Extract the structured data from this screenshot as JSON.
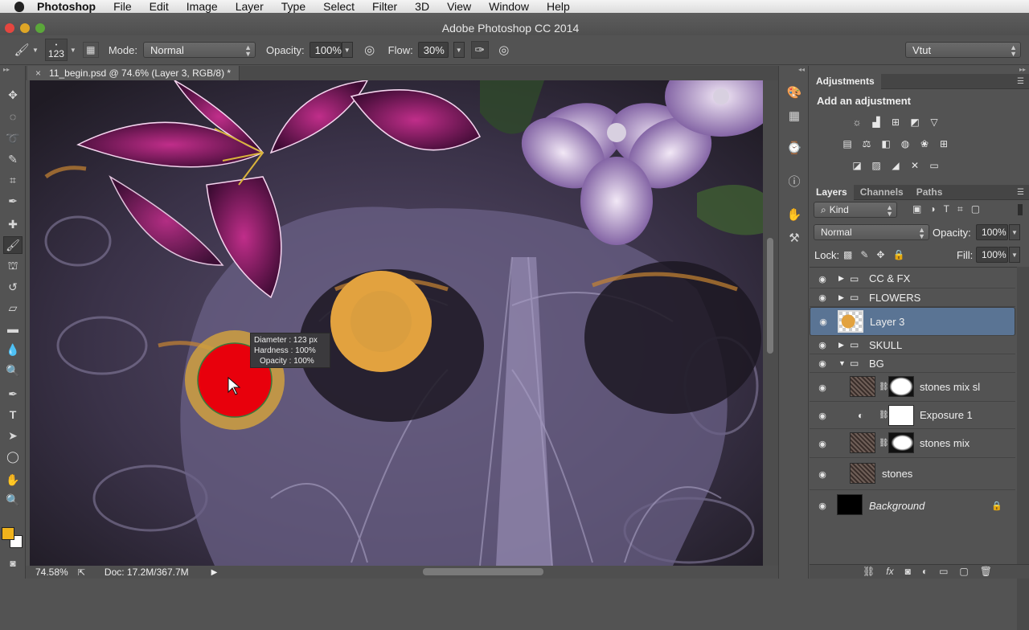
{
  "menubar": {
    "app_name": "Photoshop",
    "items": [
      "File",
      "Edit",
      "Image",
      "Layer",
      "Type",
      "Select",
      "Filter",
      "3D",
      "View",
      "Window",
      "Help"
    ]
  },
  "window": {
    "title": "Adobe Photoshop CC 2014"
  },
  "options_bar": {
    "brush_size": "123",
    "mode_label": "Mode:",
    "mode_value": "Normal",
    "opacity_label": "Opacity:",
    "opacity_value": "100%",
    "flow_label": "Flow:",
    "flow_value": "30%",
    "workspace": "Vtut"
  },
  "document": {
    "tab_title": "11_begin.psd @ 74.6% (Layer 3, RGB/8) *",
    "close_glyph": "×"
  },
  "brush_tooltip": {
    "diameter_label": "Diameter :",
    "diameter_value": "123 px",
    "hardness_label": "Hardness :",
    "hardness_value": "100%",
    "opacity_label": "Opacity :",
    "opacity_value": "100%"
  },
  "status": {
    "zoom": "74.58%",
    "doc_info": "Doc: 17.2M/367.7M"
  },
  "adjustments": {
    "panel_title": "Adjustments",
    "heading": "Add an adjustment"
  },
  "layers_panel": {
    "tabs": [
      "Layers",
      "Channels",
      "Paths"
    ],
    "filter_kind": "Kind",
    "blend_mode": "Normal",
    "opacity_label": "Opacity:",
    "opacity_value": "100%",
    "lock_label": "Lock:",
    "fill_label": "Fill:",
    "fill_value": "100%",
    "layers": [
      {
        "name": "CC & FX",
        "type": "group"
      },
      {
        "name": "FLOWERS",
        "type": "group"
      },
      {
        "name": "Layer 3",
        "type": "pixel",
        "selected": true
      },
      {
        "name": "SKULL",
        "type": "group"
      },
      {
        "name": "BG",
        "type": "group-open"
      },
      {
        "name": "stones mix sl",
        "type": "masked"
      },
      {
        "name": "Exposure 1",
        "type": "adjustment"
      },
      {
        "name": "stones mix",
        "type": "masked"
      },
      {
        "name": "stones",
        "type": "pixel"
      },
      {
        "name": "Background",
        "type": "background"
      }
    ]
  },
  "colors": {
    "foreground": "#f0b31c",
    "background": "#ffffff",
    "selection": "#5a7494",
    "brush_dab": "#e2a23f",
    "painted_red": "#e8000c"
  }
}
